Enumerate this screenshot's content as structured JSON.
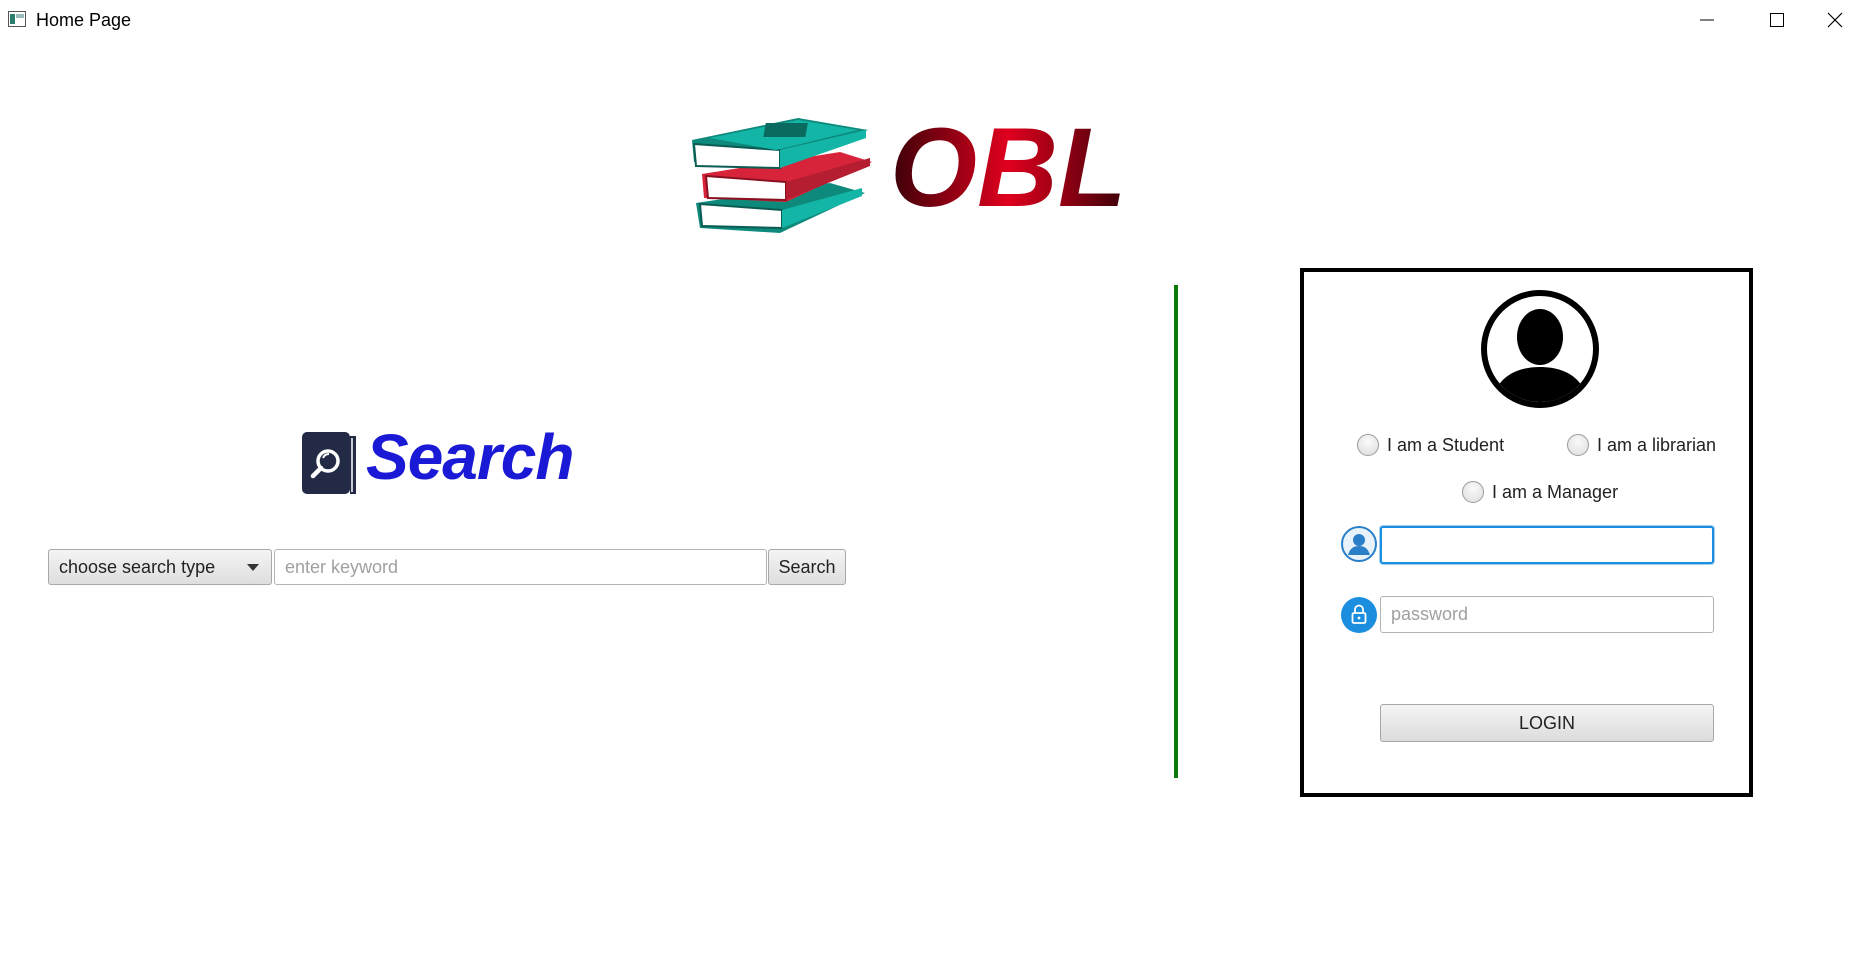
{
  "window": {
    "title": "Home Page",
    "controls": [
      "minimize",
      "maximize",
      "close"
    ]
  },
  "logo": {
    "text": "OBL",
    "icon": "books-stack-icon"
  },
  "search": {
    "heading": "Search",
    "heading_icon": "search-book-icon",
    "type_select": {
      "selected": "choose search type"
    },
    "keyword_input": {
      "value": "",
      "placeholder": "enter keyword"
    },
    "button_label": "Search"
  },
  "login": {
    "avatar_icon": "user-avatar-icon",
    "roles": [
      {
        "label": "I am a Student",
        "selected": false
      },
      {
        "label": "I am a librarian",
        "selected": false
      },
      {
        "label": "I am a Manager",
        "selected": false
      }
    ],
    "username": {
      "value": "",
      "icon": "user-icon"
    },
    "password": {
      "value": "",
      "placeholder": "password",
      "icon": "lock-icon"
    },
    "button_label": "LOGIN"
  },
  "colors": {
    "divider": "#0b7a0b",
    "focus_border": "#1c8ee0",
    "search_heading": "#1a1ad6",
    "logo_text": "#c0001a",
    "book_teal": "#13b5a6"
  }
}
